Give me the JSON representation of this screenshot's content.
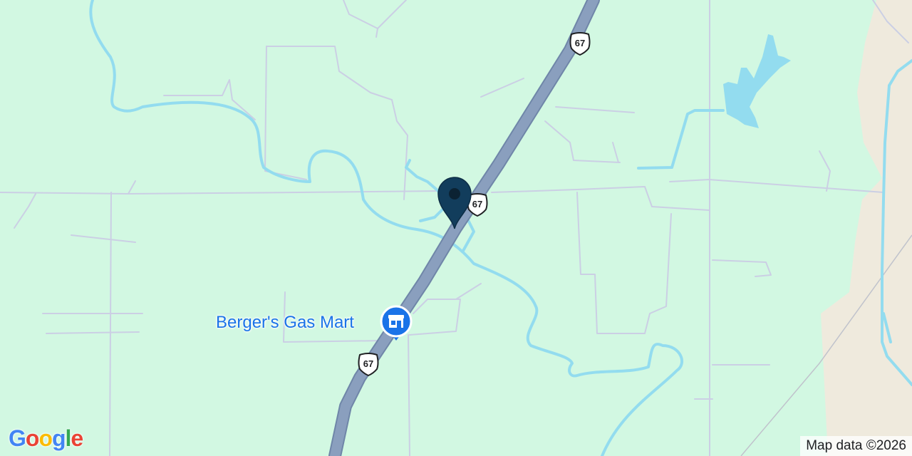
{
  "map": {
    "colors": {
      "land": "#d2f8e2",
      "urban_area": "#efeadd",
      "water": "#93dcef",
      "highway": "#8a9fbe",
      "highway_edge": "#6f86a8",
      "minor_road": "#cbcfe4",
      "rail": "#c0c3cc",
      "marker": "#123d5c",
      "poi": "#1a73e8"
    },
    "route_shields": [
      {
        "number": "67",
        "icon": "us-route-shield"
      },
      {
        "number": "67",
        "icon": "us-route-shield"
      },
      {
        "number": "67",
        "icon": "us-route-shield"
      }
    ],
    "poi": {
      "name": "Berger's Gas Mart",
      "icon": "store-icon"
    },
    "marker": {
      "icon": "location-pin-icon"
    },
    "logo": {
      "text": "Google",
      "letters": [
        "G",
        "o",
        "o",
        "g",
        "l",
        "e"
      ]
    },
    "attribution": "Map data ©2026"
  }
}
